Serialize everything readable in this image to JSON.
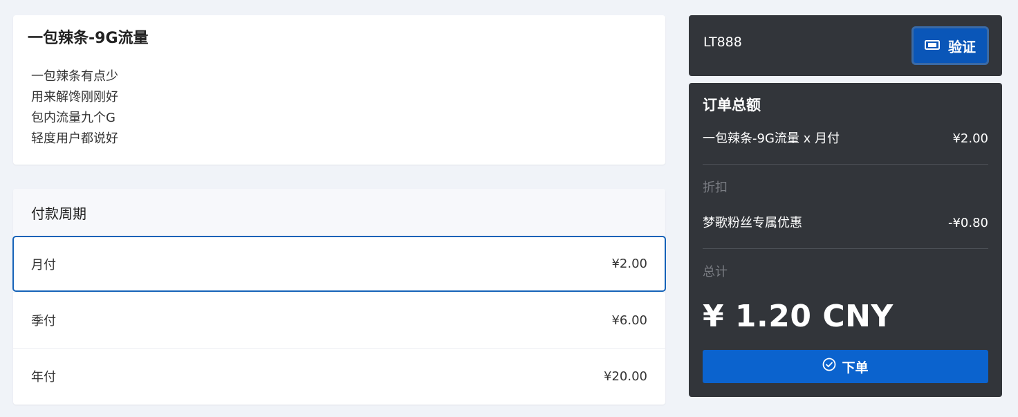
{
  "product": {
    "title": "一包辣条-9G流量",
    "description": [
      "一包辣条有点少",
      "用来解馋刚刚好",
      "包内流量九个G",
      "轻度用户都说好"
    ]
  },
  "billing": {
    "header": "付款周期",
    "options": [
      {
        "label": "月付",
        "price": "¥2.00",
        "selected": true
      },
      {
        "label": "季付",
        "price": "¥6.00",
        "selected": false
      },
      {
        "label": "年付",
        "price": "¥20.00",
        "selected": false
      }
    ]
  },
  "coupon": {
    "code": "LT888",
    "verify_label": "验证",
    "verify_icon": "ticket-icon"
  },
  "summary": {
    "title": "订单总额",
    "item_label": "一包辣条-9G流量 x 月付",
    "item_price": "¥2.00",
    "discount_header": "折扣",
    "discount_label": "梦歌粉丝专属优惠",
    "discount_amount": "-¥0.80",
    "total_header": "总计",
    "total": "¥ 1.20 CNY",
    "order_label": "下单",
    "order_icon": "check-circle-icon"
  },
  "colors": {
    "primary": "#0b63ce",
    "dark_panel": "#32353a",
    "selected_border": "#1562b8",
    "page_bg": "#f0f3f8"
  }
}
